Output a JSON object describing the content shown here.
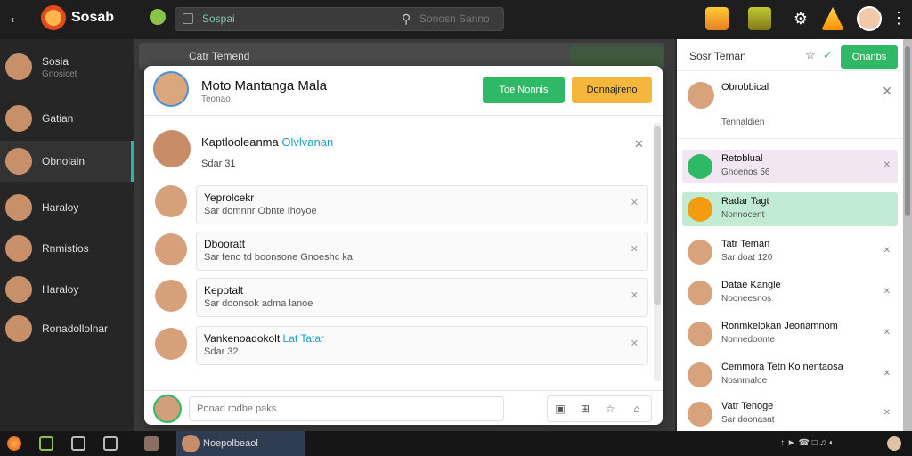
{
  "app": {
    "name": "Sosab"
  },
  "search": {
    "chip": "Sospai",
    "placeholder": "Sonosn Sanno"
  },
  "sidebar": {
    "items": [
      {
        "name": "Sosia",
        "sub": "Gnosicet"
      },
      {
        "name": "Gatian"
      },
      {
        "name": "Obnolain"
      },
      {
        "name": "Haraloy"
      },
      {
        "name": "Rnmistios"
      },
      {
        "name": "Haraloy"
      },
      {
        "name": "Ronadollolnar"
      }
    ]
  },
  "background": {
    "title": "Catr Temend"
  },
  "modal": {
    "title": "Moto Mantanga Mala",
    "subtitle": "Teonao",
    "btn_green": "Toe Nonnis",
    "btn_orange": "Donnajreno",
    "featured": {
      "name": "Kaptlooleanma",
      "link": "Olvlvanan",
      "sub": "Sdar 31"
    },
    "items": [
      {
        "name": "Yeprolcekr",
        "sub": "Sar domnnr Obnte Ihoyoe"
      },
      {
        "name": "Dbooratt",
        "sub": "Sar feno td boonsone Gnoeshc ka"
      },
      {
        "name": "Kepotalt",
        "sub": "Sar doonsok adma lanoe"
      },
      {
        "name": "Vankenoadokolt",
        "link": "Lat Tatar",
        "sub": "Sdar 32"
      }
    ],
    "footer_placeholder": "Ponad rodbe paks"
  },
  "right_panel": {
    "title": "Sosr Teman",
    "button": "Onanbs",
    "top": {
      "name": "Obrobbical",
      "sub": "Tennaldien"
    },
    "items": [
      {
        "name": "Retoblual",
        "sub": "Gnoenos 56"
      },
      {
        "name": "Radar Tagt",
        "sub": "Nonnocent"
      },
      {
        "name": "Tatr Teman",
        "sub": "Sar doat 120"
      },
      {
        "name": "Datae Kangle",
        "sub": "Nooneesnos"
      },
      {
        "name": "Ronmkelokan Jeonamnom",
        "sub": "Nonnedoonte"
      },
      {
        "name": "Cemmora Tetn Ko nentaosa",
        "sub": "Nosnrnaloe"
      },
      {
        "name": "Vatr Tenoge",
        "sub": "Sar doonasat"
      }
    ]
  },
  "taskbar": {
    "task": "Noepolbeaol"
  }
}
